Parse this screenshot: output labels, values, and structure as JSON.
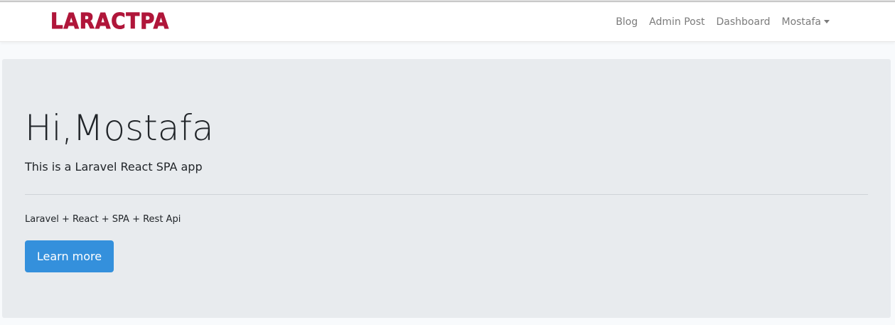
{
  "navbar": {
    "brand": "LARACTPA",
    "links": [
      {
        "label": "Blog"
      },
      {
        "label": "Admin Post"
      },
      {
        "label": "Dashboard"
      }
    ],
    "user_menu": {
      "label": "Mostafa"
    }
  },
  "hero": {
    "title": "Hi,Mostafa",
    "lead": "This is a Laravel React SPA app",
    "text": "Laravel + React + SPA + Rest Api",
    "button_label": "Learn more"
  },
  "colors": {
    "brand": "#b0163a",
    "primary_button": "#3490dc",
    "jumbotron_bg": "#e8ebee",
    "page_bg": "#f8fafc"
  }
}
